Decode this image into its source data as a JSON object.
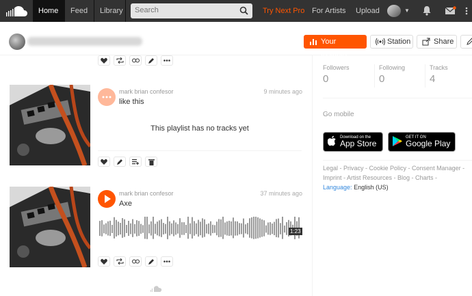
{
  "nav": {
    "home": "Home",
    "feed": "Feed",
    "library": "Library",
    "search_placeholder": "Search",
    "try_pro": "Try Next Pro",
    "for_artists": "For Artists",
    "upload": "Upload"
  },
  "header": {
    "insights": "Your Insights",
    "station": "Station",
    "share": "Share"
  },
  "feed": {
    "items": [
      {
        "user": "mark brian confesor",
        "time": "9 minutes ago",
        "title": "like this",
        "empty_message": "This playlist has no tracks yet"
      },
      {
        "user": "mark brian confesor",
        "time": "37 minutes ago",
        "title": "Axe",
        "duration": "1:23"
      }
    ]
  },
  "stats": {
    "followers_label": "Followers",
    "followers_value": "0",
    "following_label": "Following",
    "following_value": "0",
    "tracks_label": "Tracks",
    "tracks_value": "4"
  },
  "mobile": {
    "title": "Go mobile",
    "appstore_small": "Download on the",
    "appstore_big": "App Store",
    "googleplay_small": "GET IT ON",
    "googleplay_big": "Google Play"
  },
  "footer": {
    "line1": "Legal - Privacy - Cookie Policy - Consent Manager -",
    "line2": "Imprint - Artist Resources - Blog - Charts -",
    "language_label": "Language:",
    "language_value": "English (US)"
  },
  "colors": {
    "accent": "#ff5500",
    "topbar": "#333333"
  }
}
